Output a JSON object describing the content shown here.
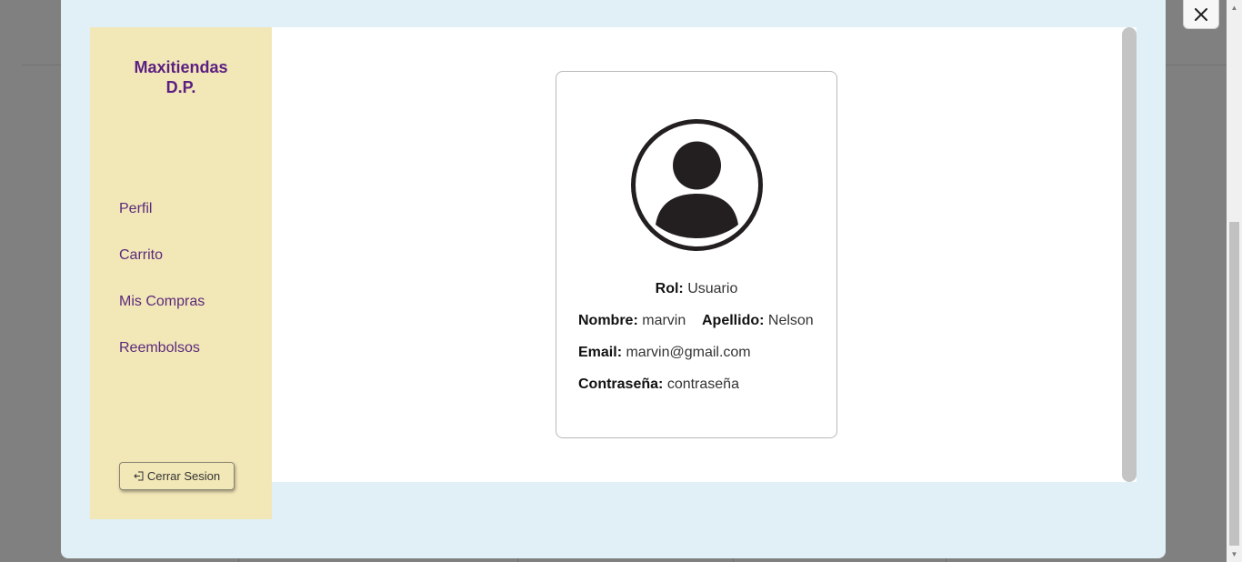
{
  "brand": {
    "line1": "Maxitiendas",
    "line2": "D.P."
  },
  "sidebar": {
    "items": [
      {
        "label": "Perfil"
      },
      {
        "label": "Carrito"
      },
      {
        "label": "Mis Compras"
      },
      {
        "label": "Reembolsos"
      }
    ],
    "logout_label": "Cerrar Sesion"
  },
  "profile": {
    "role_label": "Rol:",
    "role_value": "Usuario",
    "first_name_label": "Nombre:",
    "first_name_value": "marvin",
    "last_name_label": "Apellido:",
    "last_name_value": "Nelson",
    "email_label": "Email:",
    "email_value": "marvin@gmail.com",
    "password_label": "Contraseña:",
    "password_value": "contraseña"
  },
  "icons": {
    "close": "close-icon",
    "logout": "logout-icon",
    "avatar": "user-avatar-icon"
  },
  "colors": {
    "brand": "#5b1f82",
    "sidebar_bg": "#f2e7b7",
    "modal_bg": "#e1eff7",
    "overlay": "#808080"
  }
}
